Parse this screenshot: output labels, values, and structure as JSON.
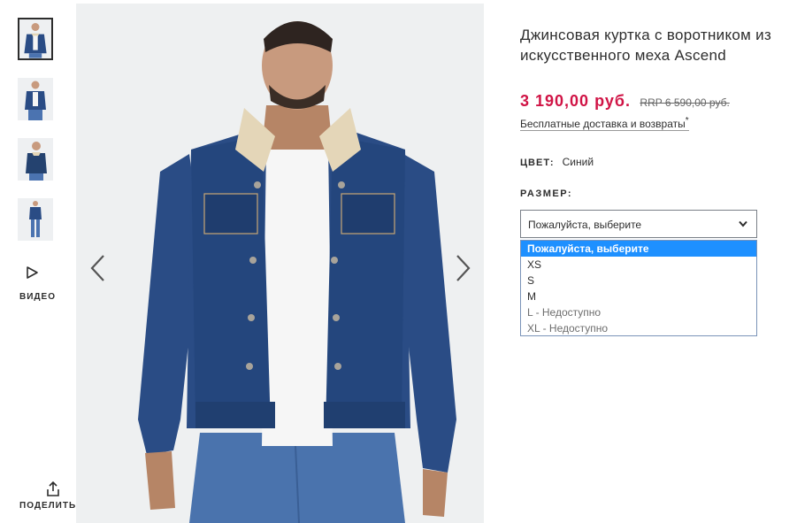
{
  "thumbnails": [
    {
      "name": "thumb-front-fur-collar",
      "active": true
    },
    {
      "name": "thumb-front-plain",
      "active": false
    },
    {
      "name": "thumb-side",
      "active": false
    },
    {
      "name": "thumb-full-body",
      "active": false
    }
  ],
  "video": {
    "label": "ВИДЕО",
    "icon": "play-icon"
  },
  "share": {
    "label": "ПОДЕЛИТЬСЯ",
    "icon": "share-icon"
  },
  "gallery": {
    "prev_icon": "chevron-left-icon",
    "next_icon": "chevron-right-icon"
  },
  "product": {
    "title": "Джинсовая куртка с воротником из искусственного меха Ascend",
    "price": "3 190,00 руб.",
    "rrp": "RRP 6 590,00 руб.",
    "delivery": "Бесплатные доставка и возвраты",
    "delivery_mark": "*",
    "color_label": "ЦВЕТ:",
    "color_value": "Синий",
    "size_label": "РАЗМЕР:"
  },
  "size_select": {
    "value": "Пожалуйста, выберите",
    "options": [
      {
        "label": "Пожалуйста, выберите",
        "state": "selected"
      },
      {
        "label": "XS",
        "state": "available"
      },
      {
        "label": "S",
        "state": "available"
      },
      {
        "label": "M",
        "state": "available"
      },
      {
        "label": "L - Недоступно",
        "state": "disabled"
      },
      {
        "label": "XL - Недоступно",
        "state": "disabled"
      }
    ]
  },
  "colors": {
    "price": "#d01345",
    "denim": "#2a4c85",
    "highlight": "#1e90ff"
  }
}
